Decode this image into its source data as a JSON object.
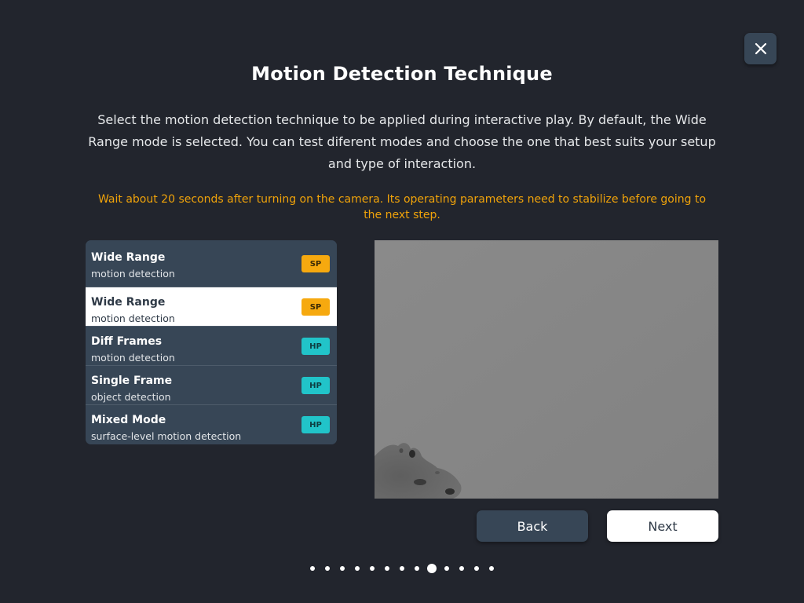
{
  "dialog": {
    "title": "Motion Detection Technique",
    "description": "Select the motion detection technique to be applied during interactive play. By default, the Wide Range mode is selected. You can test diferent modes and choose the one that best suits your setup and type of interaction.",
    "warning": "Wait about 20 seconds after turning on the camera. Its operating parameters need to stabilize before going to the next step."
  },
  "techniques": [
    {
      "name": "Wide Range",
      "subtitle": "motion detection",
      "badge": "SP",
      "selected": false
    },
    {
      "name": "Wide Range",
      "subtitle": "motion detection",
      "badge": "SP",
      "selected": true
    },
    {
      "name": "Diff Frames",
      "subtitle": "motion detection",
      "badge": "HP",
      "selected": false
    },
    {
      "name": "Single Frame",
      "subtitle": "object detection",
      "badge": "HP",
      "selected": false
    },
    {
      "name": "Mixed Mode",
      "subtitle": "surface-level motion detection",
      "badge": "HP",
      "selected": false
    }
  ],
  "buttons": {
    "back": "Back",
    "next": "Next"
  },
  "pagination": {
    "total": 13,
    "current": 9
  },
  "icons": {
    "close": "close-icon"
  },
  "colors": {
    "background": "#22252d",
    "panel": "#374656",
    "warning": "#f0a30a",
    "badge_sp": "#f6a90f",
    "badge_hp": "#21c4c9"
  }
}
